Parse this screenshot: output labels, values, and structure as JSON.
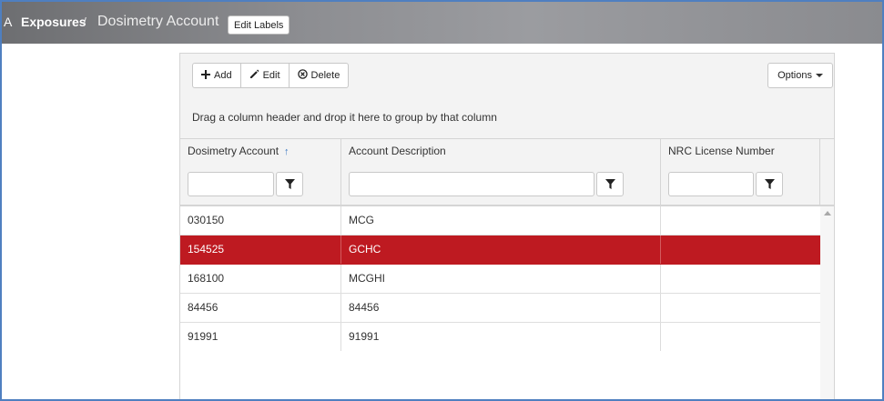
{
  "header": {
    "lead_char": "A",
    "breadcrumb_link": "Exposures",
    "breadcrumb_sep": "/",
    "breadcrumb_current": "Dosimetry Account",
    "edit_labels": "Edit Labels"
  },
  "toolbar": {
    "add_label": "Add",
    "edit_label": "Edit",
    "delete_label": "Delete",
    "options_label": "Options"
  },
  "grouping_hint": "Drag a column header and drop it here to group by that column",
  "columns": [
    {
      "label": "Dosimetry Account",
      "sort": "ascending"
    },
    {
      "label": "Account Description"
    },
    {
      "label": "NRC License Number"
    }
  ],
  "filters": {
    "account_value": "",
    "description_value": "",
    "license_value": ""
  },
  "rows": [
    {
      "account": "030150",
      "description": "MCG",
      "license": ""
    },
    {
      "account": "154525",
      "description": "GCHC",
      "license": "",
      "selected": true
    },
    {
      "account": "168100",
      "description": "MCGHI",
      "license": ""
    },
    {
      "account": "84456",
      "description": "84456",
      "license": ""
    },
    {
      "account": "91991",
      "description": "91991",
      "license": ""
    }
  ],
  "icons": {
    "add": "plus-icon",
    "edit": "pencil-icon",
    "delete": "delete-circle-icon",
    "filter": "funnel-icon",
    "sort": "arrow-up-icon"
  },
  "colors": {
    "selected_row": "#be1a21",
    "sort_arrow": "#3a78c2",
    "frame_border": "#4f7fc0"
  }
}
